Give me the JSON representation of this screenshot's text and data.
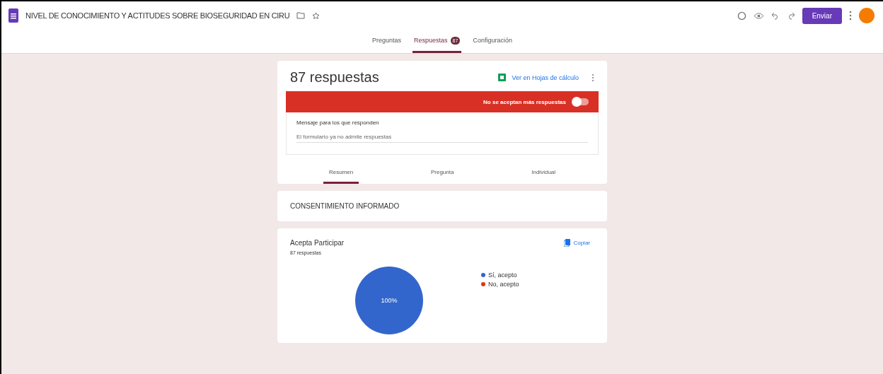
{
  "header": {
    "title": "NIVEL DE CONOCIMIENTO Y ACTITUDES SOBRE BIOSEGURIDAD EN CIRU",
    "send_label": "Enviar"
  },
  "tabs": [
    {
      "label": "Preguntas",
      "selected": false
    },
    {
      "label": "Respuestas",
      "selected": true,
      "badge": "87"
    },
    {
      "label": "Configuración",
      "selected": false
    }
  ],
  "summary": {
    "title": "87 respuestas",
    "sheets_link": "Ver en Hojas de cálculo",
    "accepting_label": "No se aceptan más respuestas",
    "accepting": false,
    "message_label": "Mensaje para los que responden",
    "message_value": "El formulario ya no admite respuestas"
  },
  "view_tabs": [
    {
      "label": "Resumen",
      "selected": true
    },
    {
      "label": "Pregunta",
      "selected": false
    },
    {
      "label": "Individual",
      "selected": false
    }
  ],
  "section": {
    "title": "CONSENTIMIENTO INFORMADO"
  },
  "question": {
    "title": "Acepta Participar",
    "count": "87 respuestas",
    "copy_label": "Copiar",
    "chart_data": {
      "type": "pie",
      "categories": [
        "Sí, acepto",
        "No, acepto"
      ],
      "values": [
        100,
        0
      ],
      "colors": [
        "#3366cc",
        "#dc3912"
      ],
      "value_labels": [
        "100%",
        null
      ]
    }
  }
}
